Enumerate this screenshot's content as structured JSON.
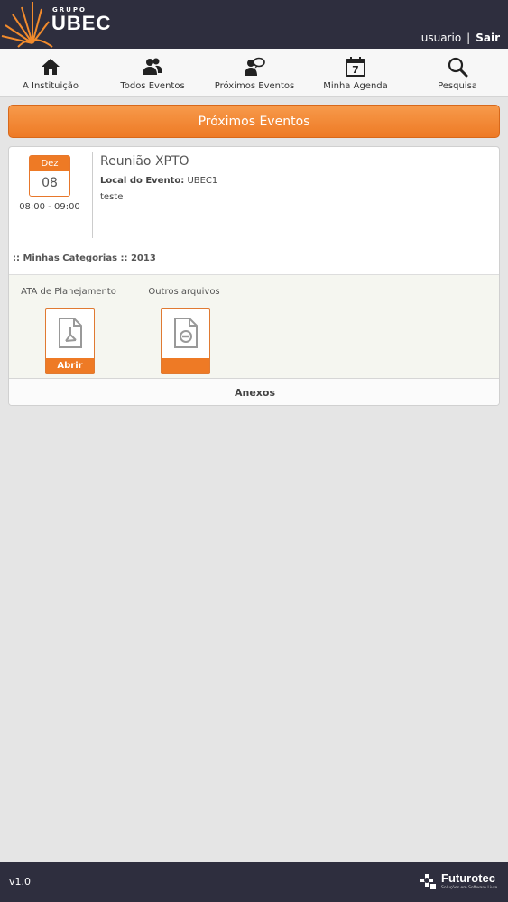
{
  "header": {
    "logo_small": "GRUPO",
    "logo_main": "UBEC",
    "user": "usuario",
    "separator": "|",
    "logout": "Sair"
  },
  "nav": {
    "items": [
      {
        "label": "A Instituição",
        "icon": "home-icon"
      },
      {
        "label": "Todos Eventos",
        "icon": "users-icon"
      },
      {
        "label": "Próximos Eventos",
        "icon": "user-chat-icon"
      },
      {
        "label": "Minha Agenda",
        "icon": "calendar-icon",
        "icon_text": "7"
      },
      {
        "label": "Pesquisa",
        "icon": "search-icon"
      }
    ]
  },
  "main": {
    "section_title": "Próximos Eventos",
    "event": {
      "month": "Dez",
      "day": "08",
      "time": "08:00 - 09:00",
      "title": "Reunião XPTO",
      "local_label": "Local do Evento:",
      "local_value": "UBEC1",
      "description": "teste",
      "categories": ":: Minhas Categorias :: 2013",
      "files": [
        {
          "label": "ATA de Planejamento",
          "button": "Abrir",
          "icon": "pdf-file-icon"
        },
        {
          "label": "Outros arquivos",
          "button": "",
          "icon": "generic-file-icon"
        }
      ],
      "attachments_label": "Anexos"
    }
  },
  "footer": {
    "version": "v1.0",
    "brand": "Futurotec",
    "brand_tagline": "Soluções em Software Livre"
  },
  "colors": {
    "accent": "#ee7a25",
    "header_bg": "#2e2e3e",
    "page_bg": "#e5e5e5"
  }
}
